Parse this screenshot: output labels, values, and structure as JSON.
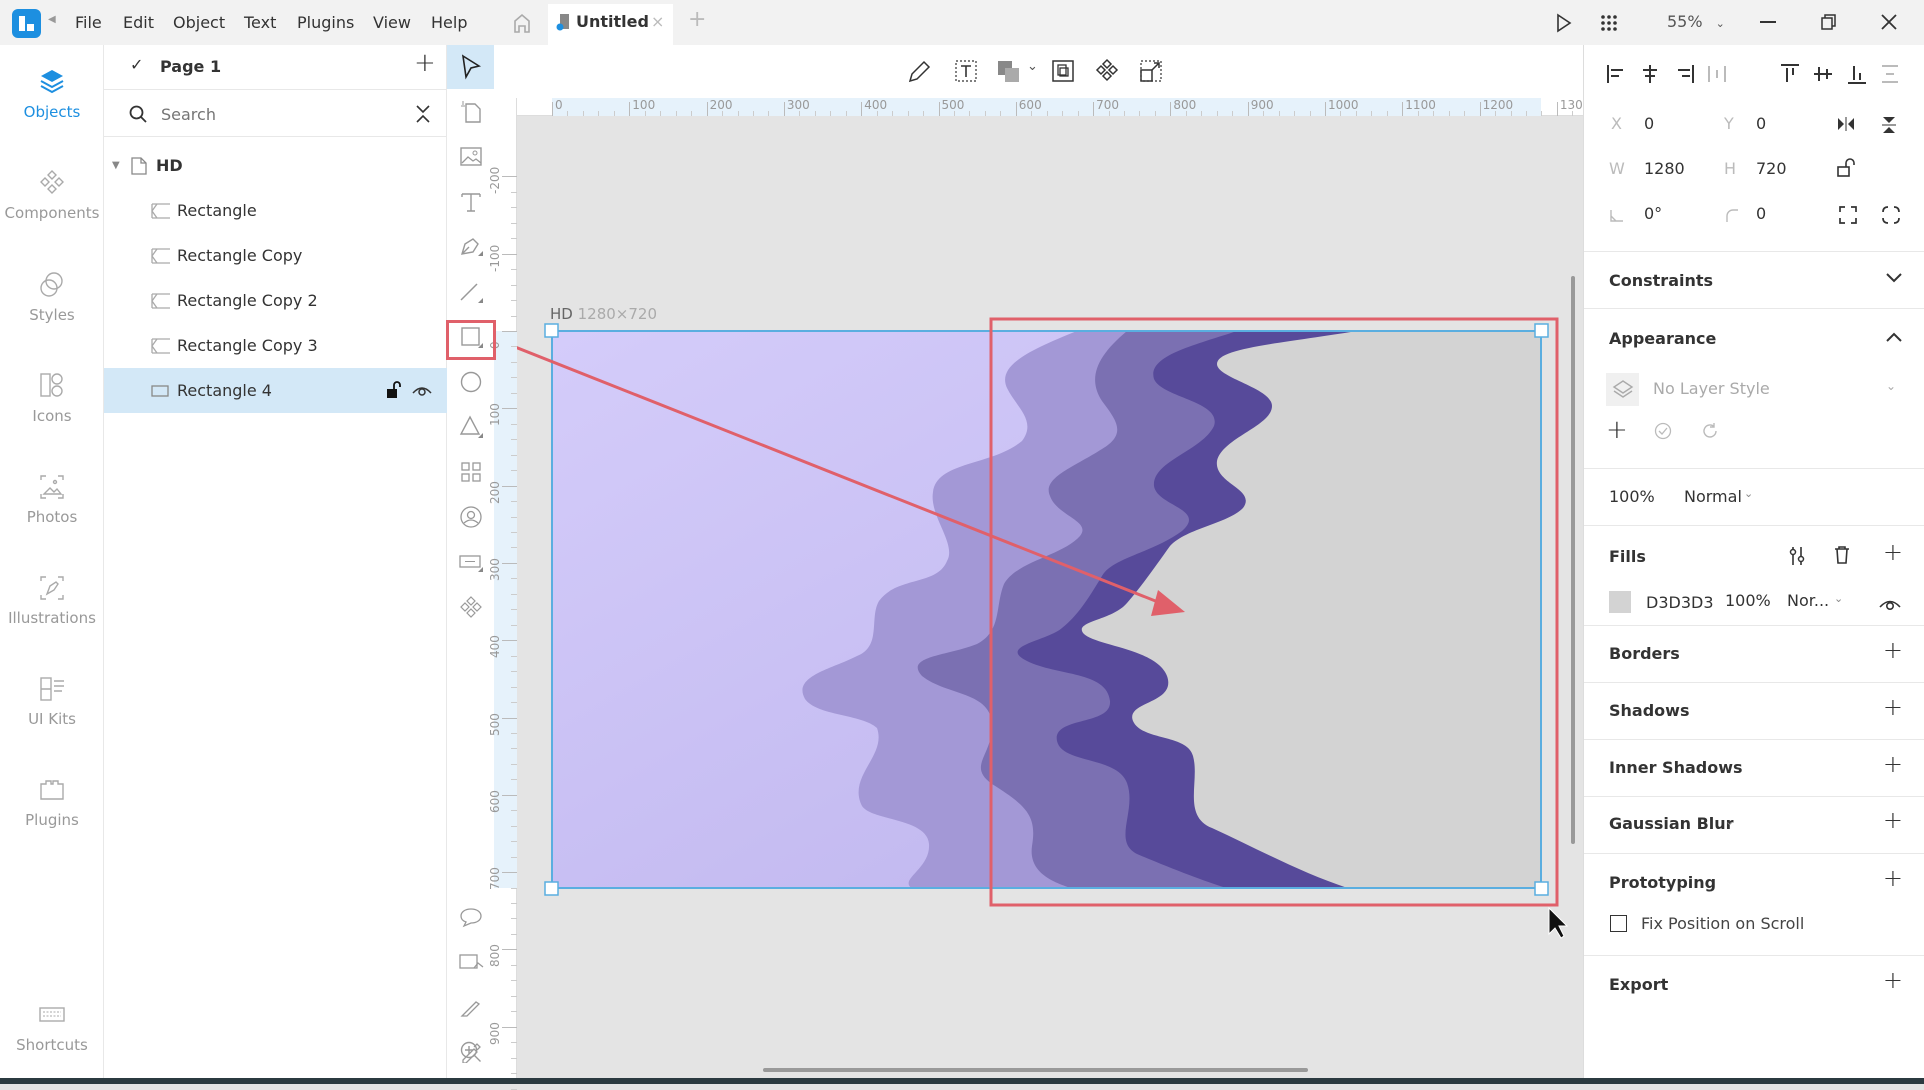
{
  "titlebar": {
    "menus": [
      "File",
      "Edit",
      "Object",
      "Text",
      "Plugins",
      "View",
      "Help"
    ],
    "tab_title": "Untitled",
    "zoom_level": "55%"
  },
  "leftrail": {
    "items": [
      {
        "label": "Objects",
        "icon": "layers-icon",
        "active": true
      },
      {
        "label": "Components",
        "icon": "components-icon"
      },
      {
        "label": "Styles",
        "icon": "styles-icon"
      },
      {
        "label": "Icons",
        "icon": "icons-icon"
      },
      {
        "label": "Photos",
        "icon": "photos-icon"
      },
      {
        "label": "Illustrations",
        "icon": "illustrations-icon"
      },
      {
        "label": "UI Kits",
        "icon": "ui-kits-icon"
      },
      {
        "label": "Plugins",
        "icon": "plugins-icon"
      }
    ],
    "shortcuts_label": "Shortcuts"
  },
  "layers": {
    "page_name": "Page 1",
    "search_placeholder": "Search",
    "artboard": "HD",
    "items": [
      "Rectangle",
      "Rectangle Copy",
      "Rectangle Copy 2",
      "Rectangle Copy 3",
      "Rectangle 4"
    ],
    "selected": "Rectangle 4"
  },
  "canvas": {
    "artboard_name": "HD",
    "artboard_size": "1280×720",
    "hruler_ticks": [
      "0",
      "100",
      "200",
      "300",
      "400",
      "500",
      "600",
      "700",
      "800",
      "900",
      "1000",
      "1100",
      "1200",
      "130"
    ],
    "vruler_ticks": [
      "-200",
      "-100",
      "0",
      "100",
      "200",
      "300",
      "400",
      "500",
      "600",
      "700",
      "800",
      "900"
    ],
    "accent_color": "#e0606a",
    "selection_color": "#5aaee0",
    "bg_gradient": [
      "#d4ccfa",
      "#bfb5ee"
    ],
    "wave_colors": [
      "#a398d6",
      "#7b70b2",
      "#574a9a",
      "#d3d3d3"
    ]
  },
  "inspector": {
    "x": {
      "label": "X",
      "value": "0"
    },
    "y": {
      "label": "Y",
      "value": "0"
    },
    "w": {
      "label": "W",
      "value": "1280"
    },
    "h": {
      "label": "H",
      "value": "720"
    },
    "rotation": "0°",
    "radius": "0",
    "constraints": "Constraints",
    "appearance": "Appearance",
    "layer_style": "No Layer Style",
    "opacity": "100%",
    "blend": "Normal",
    "fills": "Fills",
    "fill": {
      "hex": "D3D3D3",
      "opacity": "100%",
      "blend": "Nor...",
      "color": "#d3d3d3"
    },
    "borders": "Borders",
    "shadows": "Shadows",
    "inner_shadows": "Inner Shadows",
    "gaussian_blur": "Gaussian Blur",
    "prototyping": "Prototyping",
    "fix_position": "Fix Position on Scroll",
    "export": "Export"
  }
}
